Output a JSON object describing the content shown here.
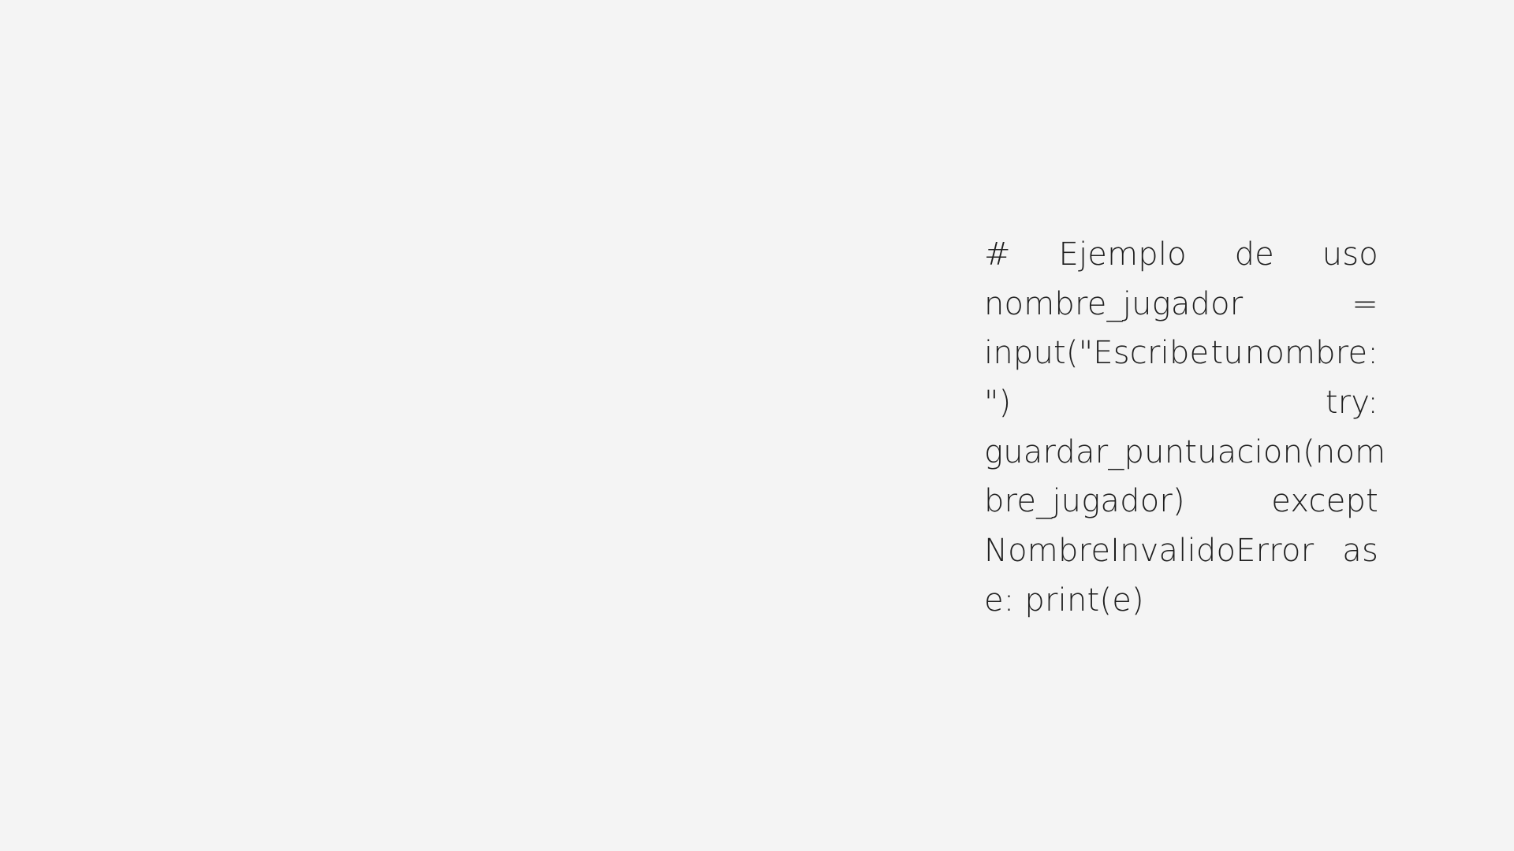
{
  "slide": {
    "code_lines": [
      [
        "#",
        "Ejemplo",
        "de",
        "uso"
      ],
      [
        "nombre_jugador",
        "="
      ],
      [
        "input(\"Escribe",
        "tu",
        "nombre:"
      ],
      [
        "\")",
        "try:"
      ],
      [
        "guardar_puntuacion(nom"
      ],
      [
        "bre_jugador)",
        "except"
      ],
      [
        "NombreInvalidoError",
        "as"
      ],
      [
        "e: print(e)"
      ]
    ]
  }
}
